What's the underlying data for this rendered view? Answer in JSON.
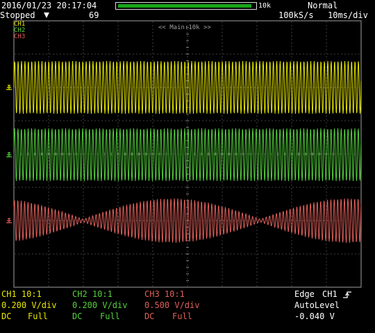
{
  "header": {
    "datetime": "2016/01/23 20:17:04",
    "memory_label": "10k",
    "memory_fill_fraction": 0.98,
    "trigger_mode": "Normal",
    "run_status": "Stopped",
    "acquisition_count": "69",
    "sample_rate": "100kS/s",
    "timebase": "10ms/div"
  },
  "display": {
    "zoom_label": "<< Main:10k >>",
    "grid_divisions": {
      "horizontal": 10,
      "vertical": 8
    },
    "colors": {
      "background": "#000000",
      "grid": "#808080",
      "ch1": "#e8e800",
      "ch2": "#54d23c",
      "ch3": "#e0605a"
    }
  },
  "legend": {
    "ch1": "CH1",
    "ch2": "CH2",
    "ch3": "CH3"
  },
  "channels": [
    {
      "label": "CH1 10:1",
      "scale": "0.200 V/div",
      "coupling": "DC",
      "bandwidth": "Full",
      "color": "#e8e800"
    },
    {
      "label": "CH2 10:1",
      "scale": "0.200 V/div",
      "coupling": "DC",
      "bandwidth": "Full",
      "color": "#54d23c"
    },
    {
      "label": "CH3 10:1",
      "scale": "0.500 V/div",
      "coupling": "DC",
      "bandwidth": "Full",
      "color": "#e0605a"
    }
  ],
  "trigger": {
    "type": "Edge",
    "source": "CH1",
    "slope_icon": "rising-edge-icon",
    "mode": "AutoLevel",
    "level": "-0.040 V"
  }
}
